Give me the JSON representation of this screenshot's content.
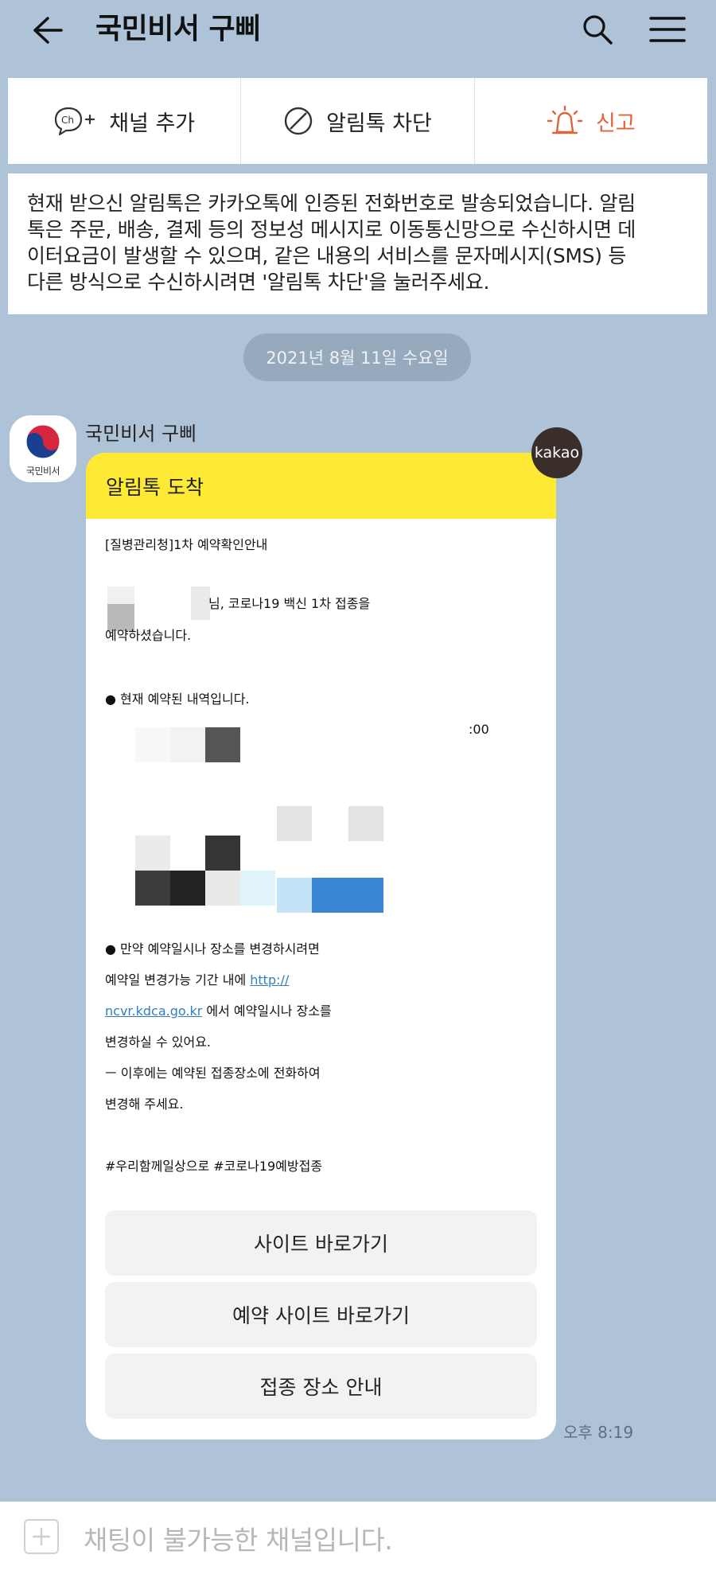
{
  "header": {
    "title": "국민비서 구삐",
    "icons": [
      "back-arrow-icon",
      "search-icon",
      "hamburger-menu-icon"
    ]
  },
  "actions": {
    "add_channel": "채널 추가",
    "block": "알림톡 차단",
    "report": "신고",
    "report_color": "#e0643a"
  },
  "notice": {
    "lines": [
      "현재 받으신 알림톡은 카카오톡에 인증된 전화번호로 발송되었습니다. 알림",
      "톡은 주문, 배송, 결제 등의 정보성 메시지로 이동통신망으로 수신하시면 데",
      "이터요금이 발생할 수 있으며, 같은 내용의 서비스를 문자메시지(SMS) 등",
      "다른 방식으로 수신하시려면 '알림톡 차단'을 눌러주세요."
    ]
  },
  "date_chip": "2021년 8월 11일 수요일",
  "sender": {
    "name": "국민비서 구삐",
    "avatar_label": "국민비서"
  },
  "message": {
    "header": "알림톡 도착",
    "badge": "kakao",
    "header_color": "#fee935",
    "title_line": "[질병관리청]1차 예약확인안내",
    "greet_line1_suffix": "님, 코로나19 백신 1차 접종을",
    "greet_line2": "예약하셨습니다.",
    "current_heading": "● 현재 예약된 내역입니다.",
    "time_fragment": ":00",
    "change_line1": "● 만약 예약일시나 장소를 변경하시려면",
    "change_line2_prefix": "예약일 변경가능 기간 내에 ",
    "link_part1": "http://",
    "link_part2": "ncvr.kdca.go.kr",
    "change_line3_suffix": " 에서 예약일시나 장소를",
    "change_line4": "변경하실 수 있어요.",
    "after_line1": "ㅡ 이후에는 예약된 접종장소에 전화하여",
    "after_line2": "변경해 주세요.",
    "hashtags": "#우리함께일상으로 #코로나19예방접종",
    "buttons": [
      "사이트 바로가기",
      "예약 사이트 바로가기",
      "접종 장소 안내"
    ]
  },
  "time": "오후 8:19",
  "input_placeholder": "채팅이 불가능한 채널입니다."
}
